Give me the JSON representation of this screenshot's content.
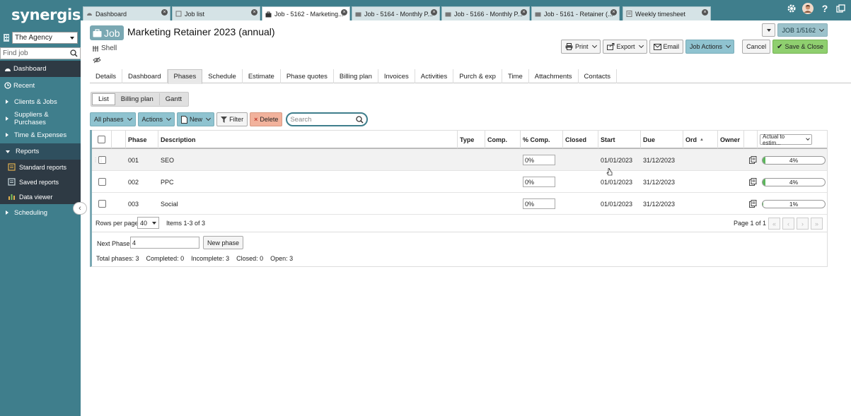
{
  "app": {
    "logo": "synergist",
    "agency": "The Agency",
    "find_placeholder": "Find job"
  },
  "sidebar": {
    "items": [
      {
        "label": "Dashboard",
        "icon": "dashboard-icon"
      },
      {
        "label": "Recent",
        "icon": "recent-icon"
      },
      {
        "label": "Clients & Jobs"
      },
      {
        "label": "Suppliers & Purchases"
      },
      {
        "label": "Time & Expenses"
      },
      {
        "label": "Reports"
      },
      {
        "label": "Scheduling"
      }
    ],
    "report_subitems": [
      {
        "label": "Standard reports",
        "icon": "report-icon"
      },
      {
        "label": "Saved reports",
        "icon": "saved-report-icon"
      },
      {
        "label": "Data viewer",
        "icon": "bar-chart-icon"
      }
    ]
  },
  "tabs": [
    {
      "label": "Dashboard"
    },
    {
      "label": "Job list"
    },
    {
      "label": "Job - 5162 - Marketing..."
    },
    {
      "label": "Job - 5164 - Monthly P..."
    },
    {
      "label": "Job - 5166 - Monthly P..."
    },
    {
      "label": "Job - 5161 - Retainer (..."
    },
    {
      "label": "Weekly timesheet"
    }
  ],
  "job": {
    "badge": "Job",
    "title": "Marketing Retainer 2023 (annual)",
    "shell": "Shell",
    "job_number": "JOB 1/5162"
  },
  "toolbar": {
    "print": "Print",
    "export": "Export",
    "email": "Email",
    "job_actions": "Job Actions",
    "cancel": "Cancel",
    "save_close": "Save & Close"
  },
  "subtabs": [
    "Details",
    "Dashboard",
    "Phases",
    "Schedule",
    "Estimate",
    "Phase quotes",
    "Billing plan",
    "Invoices",
    "Activities",
    "Purch & exp",
    "Time",
    "Attachments",
    "Contacts"
  ],
  "views": [
    "List",
    "Billing plan",
    "Gantt"
  ],
  "grid_toolbar": {
    "all_phases": "All phases",
    "actions": "Actions",
    "new": "New",
    "filter": "Filter",
    "delete": "Delete",
    "search_placeholder": "Search"
  },
  "table": {
    "columns": [
      "Phase",
      "Description",
      "Type",
      "Comp.",
      "% Comp.",
      "Closed",
      "Start",
      "Due",
      "Ord",
      "Owner"
    ],
    "progress_select": "Actual to estim...",
    "rows": [
      {
        "phase": "001",
        "description": "SEO",
        "pct": "0%",
        "start": "01/01/2023",
        "due": "31/12/2023",
        "progress_label": "4%",
        "progress_value": 0.04
      },
      {
        "phase": "002",
        "description": "PPC",
        "pct": "0%",
        "start": "01/01/2023",
        "due": "31/12/2023",
        "progress_label": "4%",
        "progress_value": 0.04
      },
      {
        "phase": "003",
        "description": "Social",
        "pct": "0%",
        "start": "01/01/2023",
        "due": "31/12/2023",
        "progress_label": "1%",
        "progress_value": 0.01
      }
    ]
  },
  "pager": {
    "rows_per_page_label": "Rows per page",
    "rows_per_page": "40",
    "items": "Items 1-3 of 3",
    "page": "Page 1 of 1"
  },
  "new_phase": {
    "label": "Next Phase",
    "value": "4",
    "button": "New phase"
  },
  "totals": {
    "total": "Total phases:  3",
    "completed": "Completed:  0",
    "incomplete": "Incomplete:  3",
    "closed": "Closed:  0",
    "open": "Open:  3"
  },
  "colors": {
    "brand": "#3f7e8c",
    "nav_dark": "#2e3a44",
    "accent_teal": "#8fc3d0",
    "save_green": "#8fcf6f",
    "delete_pink": "#f2b29c",
    "progress_green": "#5bb55b"
  }
}
